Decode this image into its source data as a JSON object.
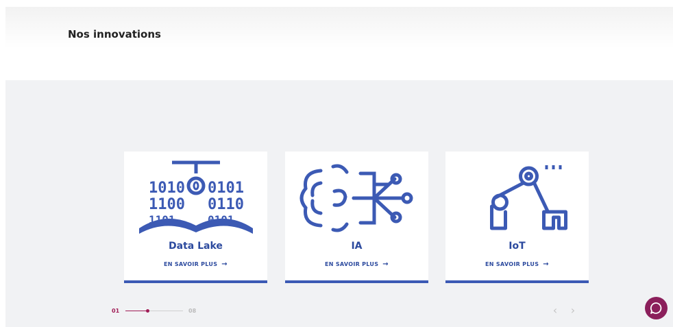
{
  "section": {
    "title": "Nos innovations"
  },
  "cards": [
    {
      "label": "Data Lake",
      "cta": "EN SAVOIR PLUS",
      "icon": "data-lake-icon"
    },
    {
      "label": "IA",
      "cta": "EN SAVOIR PLUS",
      "icon": "brain-circuit-icon"
    },
    {
      "label": "IoT",
      "cta": "EN SAVOIR PLUS",
      "icon": "robot-arm-icon"
    }
  ],
  "pager": {
    "current": "01",
    "total": "08",
    "progress": 0.38
  },
  "colors": {
    "accent": "#3c5ab4",
    "brand": "#8b1f5b",
    "pager": "#a01c55",
    "band": "#f1f2f4"
  }
}
